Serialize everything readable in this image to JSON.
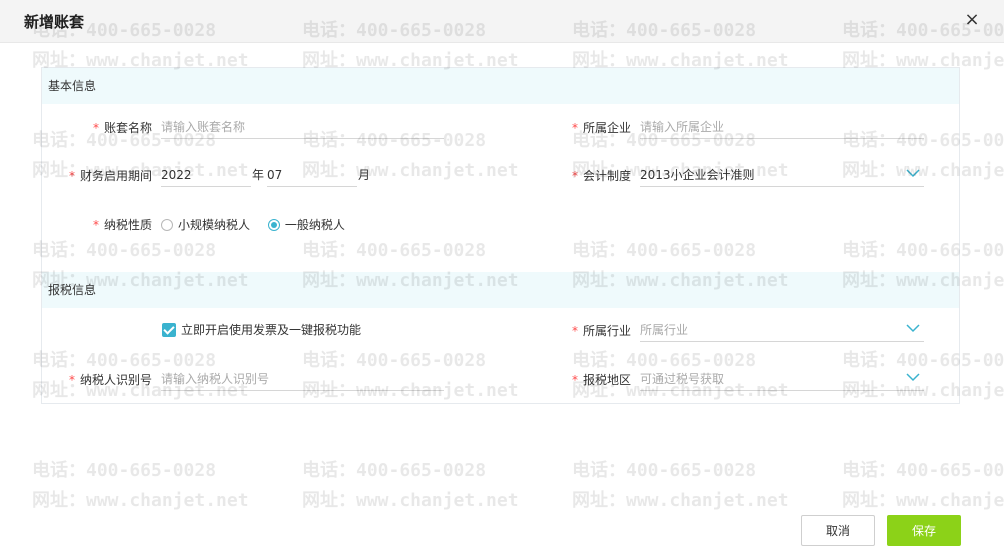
{
  "dialog": {
    "title": "新增账套",
    "close_icon": "×"
  },
  "watermark": {
    "phone": "电话：400-665-0028",
    "site": "网址：www.chanjet.net"
  },
  "sections": {
    "basic": "基本信息",
    "tax": "报税信息"
  },
  "form": {
    "book_name": {
      "required": "*",
      "label": "账套名称",
      "placeholder": "请输入账套名称"
    },
    "company": {
      "required": "*",
      "label": "所属企业",
      "placeholder": "请输入所属企业"
    },
    "start_period": {
      "required": "*",
      "label": "财务启用期间",
      "year": "2022",
      "year_unit": "年",
      "month": "07",
      "month_unit": "月"
    },
    "accounting_system": {
      "required": "*",
      "label": "会计制度",
      "value": "2013小企业会计准则"
    },
    "taxpayer_type": {
      "required": "*",
      "label": "纳税性质",
      "options": [
        "小规模纳税人",
        "一般纳税人"
      ],
      "selected": "一般纳税人"
    },
    "invoice_toggle": {
      "label": "立即开启使用发票及一键报税功能",
      "checked": true
    },
    "industry": {
      "required": "*",
      "label": "所属行业",
      "placeholder": "所属行业"
    },
    "taxpayer_id": {
      "required": "*",
      "label": "纳税人识别号",
      "placeholder": "请输入纳税人识别号"
    },
    "tax_region": {
      "required": "*",
      "label": "报税地区",
      "placeholder": "可通过税号获取"
    }
  },
  "buttons": {
    "cancel": "取消",
    "save": "保存"
  },
  "colors": {
    "accent": "#3ab3cf",
    "save": "#8cd218",
    "required": "#ff4b4b",
    "section_bg": "#effafc"
  }
}
